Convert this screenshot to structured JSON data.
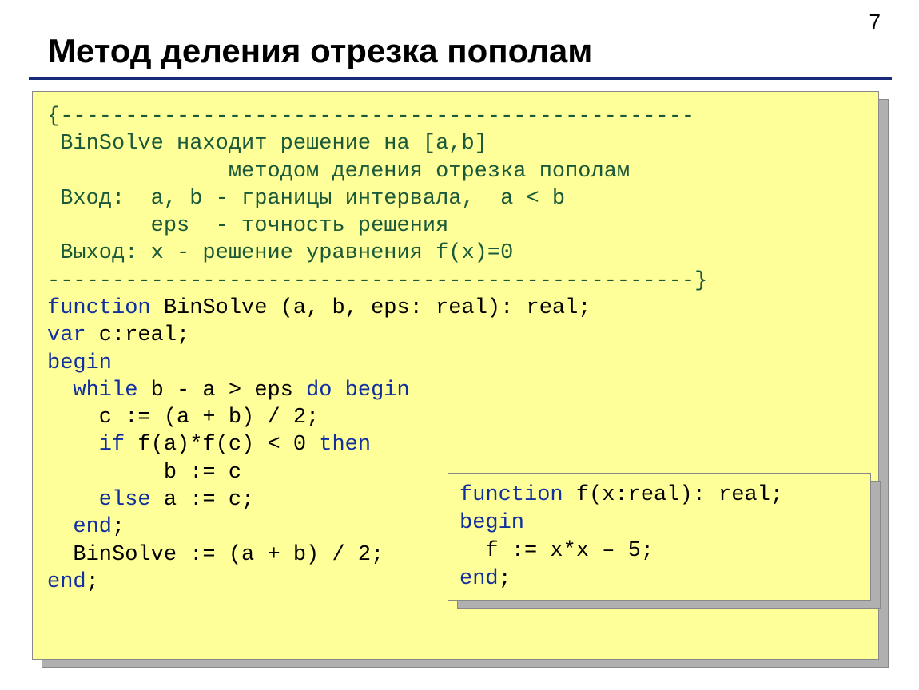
{
  "page_number": "7",
  "title": "Метод деления отрезка пополам",
  "comment_lines": {
    "l1": "{-------------------------------------------------",
    "l2": " BinSolve находит решение на [a,b]",
    "l3": "              методом деления отрезка пополам",
    "l4": " Вход:  a, b - границы интервала,  a < b",
    "l5": "        eps  - точность решения",
    "l6": " Выход: x - решение уравнения f(x)=0",
    "l7": "--------------------------------------------------}"
  },
  "code": {
    "l1a": "function",
    "l1b": " BinSolve (a, b, eps: real): real;",
    "l2a": "var",
    "l2b": " c:real;",
    "l3": "begin",
    "l4a": "  while",
    "l4b": " b - a > eps ",
    "l4c": "do begin",
    "l5": "    c := (a + b) / 2;",
    "l6a": "    if",
    "l6b": " f(a)*f(c) < 0 ",
    "l6c": "then",
    "l7": "         b := c",
    "l8a": "    else",
    "l8b": " a := c;",
    "l9a": "  end",
    "l9b": ";",
    "l10": "  BinSolve := (a + b) / 2;",
    "l11a": "end",
    "l11b": ";"
  },
  "sub": {
    "l1a": "function",
    "l1b": " f(x:real): real;",
    "l2": "begin",
    "l3": "  f := x*x – 5;",
    "l4a": "end",
    "l4b": ";"
  }
}
